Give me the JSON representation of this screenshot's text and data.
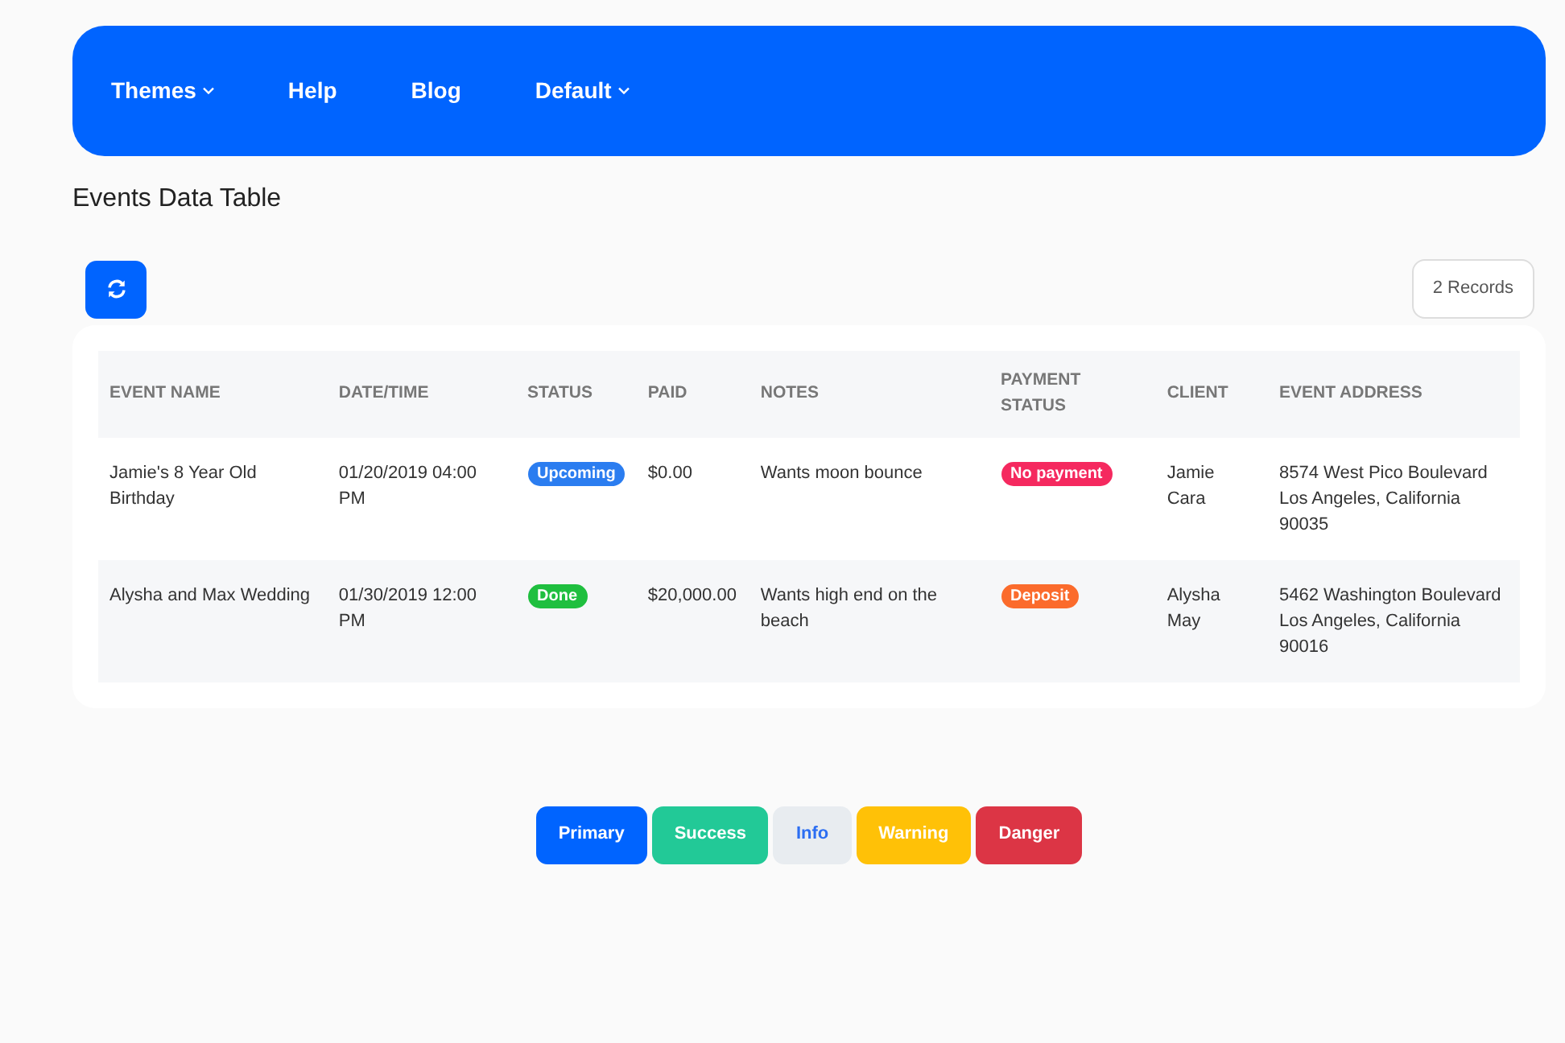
{
  "navbar": {
    "items": [
      {
        "label": "Themes",
        "dropdown": true
      },
      {
        "label": "Help",
        "dropdown": false
      },
      {
        "label": "Blog",
        "dropdown": false
      },
      {
        "label": "Default",
        "dropdown": true
      }
    ]
  },
  "title": "Events Data Table",
  "toolbar": {
    "records": "2 Records"
  },
  "table": {
    "columns": [
      "EVENT NAME",
      "DATE/TIME",
      "STATUS",
      "PAID",
      "NOTES",
      "PAYMENT STATUS",
      "CLIENT",
      "EVENT ADDRESS"
    ],
    "rows": [
      {
        "event_name": "Jamie's 8 Year Old Birthday",
        "datetime": "01/20/2019 04:00 PM",
        "status": {
          "label": "Upcoming",
          "color": "#2b7df0"
        },
        "paid": "$0.00",
        "notes": "Wants moon bounce",
        "payment_status": {
          "label": "No payment",
          "color": "#f5295f"
        },
        "client": "Jamie Cara",
        "address": [
          "8574 West Pico Boulevard",
          "Los Angeles, California",
          "90035"
        ]
      },
      {
        "event_name": "Alysha and Max Wedding",
        "datetime": "01/30/2019 12:00 PM",
        "status": {
          "label": "Done",
          "color": "#1fbf3f"
        },
        "paid": "$20,000.00",
        "notes": "Wants high end on the beach",
        "payment_status": {
          "label": "Deposit",
          "color": "#fb6b2c"
        },
        "client": "Alysha May",
        "address": [
          "5462 Washington Boulevard",
          "Los Angeles, California",
          "90016"
        ]
      }
    ]
  },
  "buttons": [
    {
      "label": "Primary",
      "kind": "primary"
    },
    {
      "label": "Success",
      "kind": "success"
    },
    {
      "label": "Info",
      "kind": "info"
    },
    {
      "label": "Warning",
      "kind": "warning"
    },
    {
      "label": "Danger",
      "kind": "danger"
    }
  ]
}
